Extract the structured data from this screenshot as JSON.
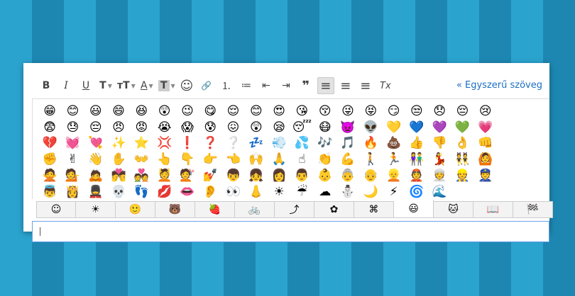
{
  "toolbar": {
    "bold": "B",
    "italic": "I",
    "underline": "U",
    "font": "T",
    "size": "тT",
    "color": "A",
    "highlight": "T",
    "emoji": "☺",
    "link": "🔗",
    "numbered_list": "⒈",
    "bullet_list": "≔",
    "outdent": "⇤",
    "indent": "⇥",
    "quote": "❞",
    "align_left": "≡",
    "align_center": "≡",
    "align_right": "≡",
    "clear": "Tx",
    "plain_text_link": "« Egyszerű szöveg"
  },
  "emojis": [
    "😁",
    "😊",
    "😃",
    "😄",
    "😆",
    "😲",
    "😉",
    "😋",
    "😌",
    "😊",
    "😍",
    "😘",
    "😚",
    "😜",
    "😝",
    "😏",
    "😒",
    "😞",
    "😔",
    "😢",
    "😨",
    "😓",
    "😔",
    "😠",
    "😡",
    "😭",
    "😱",
    "😰",
    "😖",
    "😲",
    "😪",
    "😴",
    "😷",
    "👿",
    "👽",
    "💛",
    "💙",
    "💜",
    "💚",
    "💗",
    "💔",
    "💓",
    "💘",
    "✨",
    "⭐",
    "💢",
    "❗",
    "❓",
    "❔",
    "💤",
    "💨",
    "💦",
    "🎶",
    "🎵",
    "🔥",
    "💩",
    "👍",
    "👎",
    "👌",
    "👊",
    "✊",
    "✌",
    "👋",
    "✋",
    "👐",
    "👆",
    "👇",
    "👉",
    "👈",
    "🙌",
    "🙏",
    "☝",
    "👏",
    "💪",
    "🚶",
    "🏃",
    "👫",
    "💃",
    "👯",
    "🙆",
    "🙅",
    "💁",
    "🙇",
    "💏",
    "💑",
    "💆",
    "💇",
    "💅",
    "👦",
    "👧",
    "👩",
    "👨",
    "👶",
    "👵",
    "👴",
    "👱",
    "👲",
    "👳",
    "👷",
    "👮",
    "👼",
    "👸",
    "💂",
    "💀",
    "👣",
    "💋",
    "👄",
    "👂",
    "👀",
    "👃",
    "☀",
    "☔",
    "☁",
    "⛄",
    "🌙",
    "⚡",
    "🌀",
    "🌊",
    "",
    ""
  ],
  "tabs": [
    "☺",
    "☀",
    "🙂",
    "🐻",
    "🍓",
    "🚲",
    "⤴",
    "✿",
    "⌘",
    "😃",
    "🐱",
    "📖",
    "🏁"
  ]
}
